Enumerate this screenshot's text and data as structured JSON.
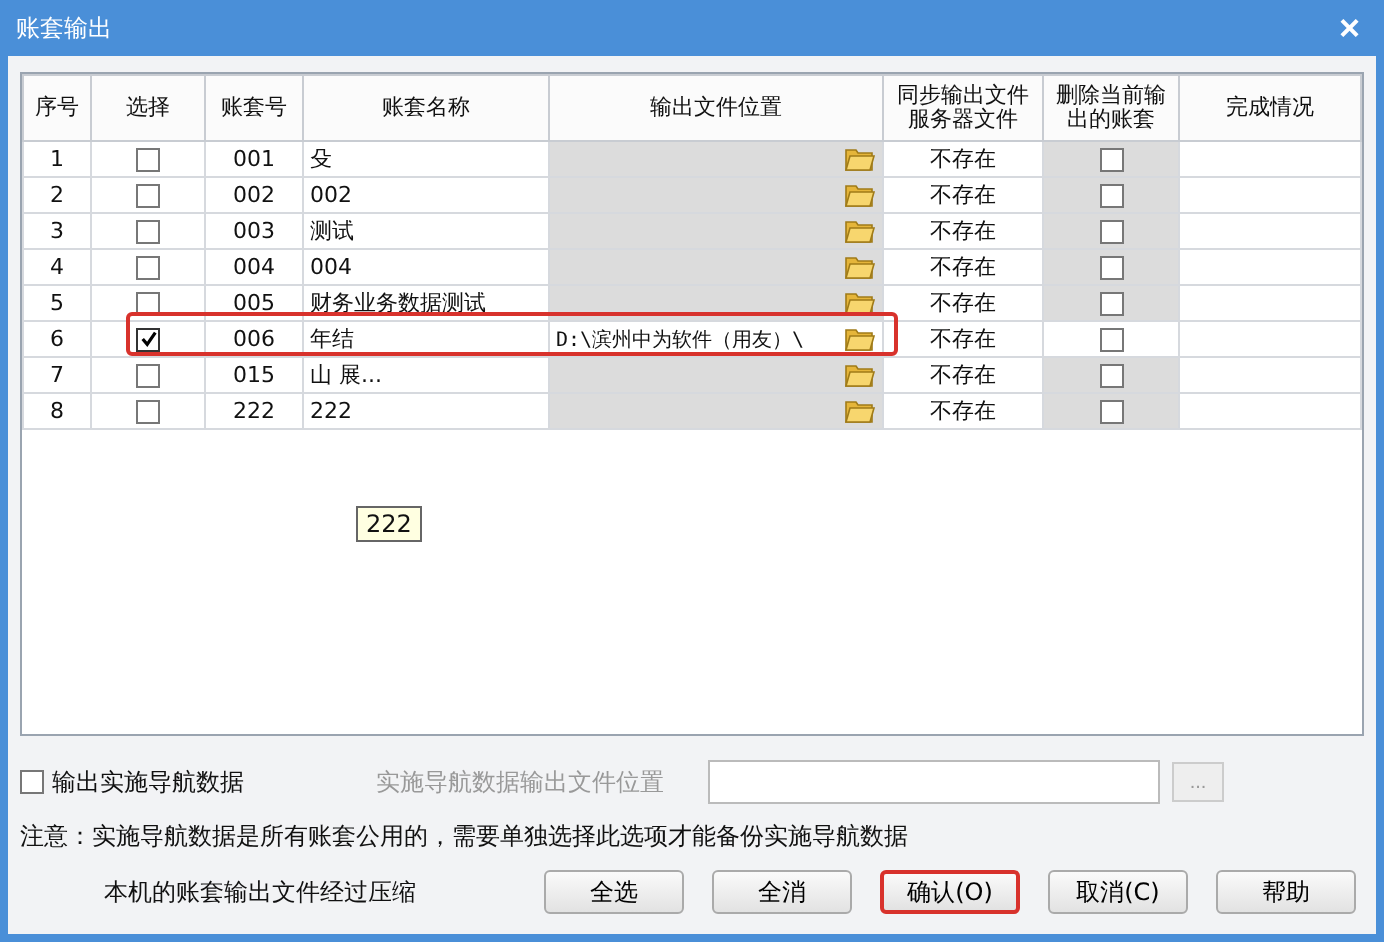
{
  "window": {
    "title": "账套输出",
    "close": "×"
  },
  "table": {
    "columns": [
      "序号",
      "选择",
      "账套号",
      "账套名称",
      "输出文件位置",
      "同步输出文件服务器文件",
      "删除当前输出的账套",
      "完成情况"
    ],
    "rows": [
      {
        "index": "1",
        "checked": false,
        "code": "001",
        "name": "殳",
        "path": "",
        "server": "不存在",
        "delete": false,
        "highlighted": false
      },
      {
        "index": "2",
        "checked": false,
        "code": "002",
        "name": "002",
        "path": "",
        "server": "不存在",
        "delete": false,
        "highlighted": false
      },
      {
        "index": "3",
        "checked": false,
        "code": "003",
        "name": "测试",
        "path": "",
        "server": "不存在",
        "delete": false,
        "highlighted": false
      },
      {
        "index": "4",
        "checked": false,
        "code": "004",
        "name": "004",
        "path": "",
        "server": "不存在",
        "delete": false,
        "highlighted": false
      },
      {
        "index": "5",
        "checked": false,
        "code": "005",
        "name": "财务业务数据测试",
        "path": "",
        "server": "不存在",
        "delete": false,
        "highlighted": false
      },
      {
        "index": "6",
        "checked": true,
        "code": "006",
        "name": "年结",
        "path": "D:\\滨州中为软件（用友）\\",
        "server": "不存在",
        "delete": false,
        "highlighted": true
      },
      {
        "index": "7",
        "checked": false,
        "code": "015",
        "name": "山            展...",
        "path": "",
        "server": "不存在",
        "delete": false,
        "highlighted": false
      },
      {
        "index": "8",
        "checked": false,
        "code": "222",
        "name": "222",
        "path": "",
        "server": "不存在",
        "delete": false,
        "highlighted": false
      }
    ]
  },
  "tooltip": "222",
  "nav_export": {
    "label": "输出实施导航数据",
    "checked": false,
    "location_label": "实施导航数据输出文件位置",
    "browse": "..."
  },
  "note": "注意：实施导航数据是所有账套公用的，需要单独选择此选项才能备份实施导航数据",
  "compress_note": "本机的账套输出文件经过压缩",
  "buttons": [
    {
      "label": "全选",
      "highlighted": false
    },
    {
      "label": "全消",
      "highlighted": false
    },
    {
      "label": "确认(O)",
      "highlighted": true
    },
    {
      "label": "取消(C)",
      "highlighted": false
    },
    {
      "label": "帮助",
      "highlighted": false
    }
  ]
}
